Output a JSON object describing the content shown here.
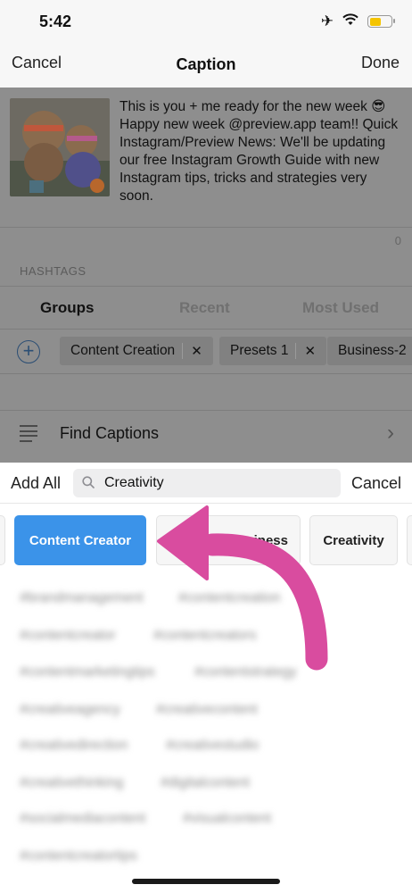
{
  "status_bar": {
    "time": "5:42",
    "icons": [
      "airplane-icon",
      "wifi-icon",
      "battery-icon"
    ],
    "battery_color": "#f5c400"
  },
  "nav": {
    "cancel_label": "Cancel",
    "title": "Caption",
    "done_label": "Done"
  },
  "caption": {
    "text": "This is you + me ready for the new week 😎 Happy new week @preview.app team!! Quick Instagram/Preview News: We'll be updating our free Instagram Growth Guide with new Instagram tips, tricks and strategies very soon.",
    "char_count": "0"
  },
  "hashtags": {
    "section_label": "HASHTAGS",
    "tabs": [
      "Groups",
      "Recent",
      "Most Used"
    ],
    "groups": [
      "Content Creation",
      "Presets 1",
      "Business-2"
    ]
  },
  "find_captions": {
    "label": "Find Captions"
  },
  "search": {
    "add_all_label": "Add All",
    "value": "Creativity",
    "cancel_label": "Cancel"
  },
  "categories": {
    "items": [
      "Content Creator",
      "Business",
      "Creativity"
    ],
    "active_color": "#3b93e9"
  },
  "blurred_hashtags": [
    "#brandmanagement",
    "#contentcreation",
    "#contentcreator",
    "#contentcreators",
    "#contentmarketingtips",
    "#contentstrategy",
    "#creativeagency",
    "#creativecontent",
    "#creativedirection",
    "#creativestudio",
    "#creativethinking",
    "#digitalcontent",
    "#socialmediacontent",
    "#visualcontent",
    "#contentcreatortips"
  ],
  "annotation": {
    "arrow_color": "#d94c9f"
  }
}
